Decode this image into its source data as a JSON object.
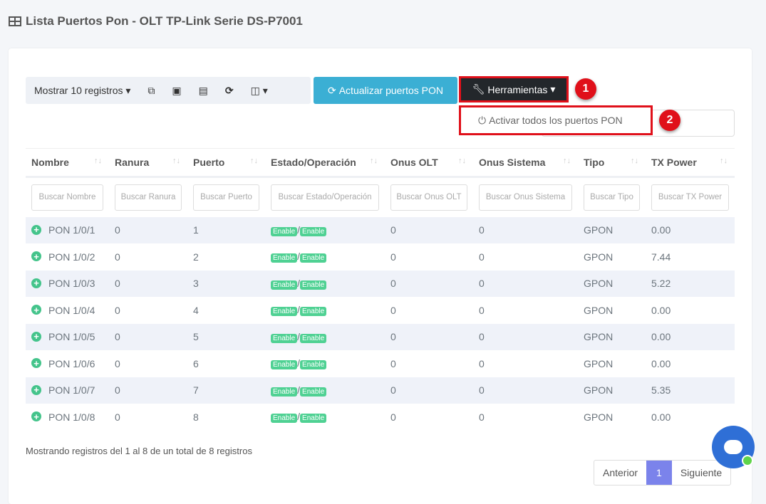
{
  "title": "Lista Puertos Pon - OLT TP-Link Serie DS-P7001",
  "toolbar": {
    "show": "Mostrar 10 registros",
    "update": "Actualizar puertos PON",
    "tools": "Herramientas",
    "menu_item": "Activar todos los puertos PON",
    "marker1": "1",
    "marker2": "2"
  },
  "columns": [
    "Nombre",
    "Ranura",
    "Puerto",
    "Estado/Operación",
    "Onus OLT",
    "Onus Sistema",
    "Tipo",
    "TX Power"
  ],
  "filters": [
    "Buscar Nombre",
    "Buscar Ranura",
    "Buscar Puerto",
    "Buscar Estado/Operación",
    "Buscar Onus OLT",
    "Buscar Onus Sistema",
    "Buscar Tipo",
    "Buscar TX Power"
  ],
  "rows": [
    {
      "name": "PON 1/0/1",
      "slot": "0",
      "port": "1",
      "state": "Enable",
      "op": "Enable",
      "olt": "0",
      "sys": "0",
      "type": "GPON",
      "tx": "0.00"
    },
    {
      "name": "PON 1/0/2",
      "slot": "0",
      "port": "2",
      "state": "Enable",
      "op": "Enable",
      "olt": "0",
      "sys": "0",
      "type": "GPON",
      "tx": "7.44"
    },
    {
      "name": "PON 1/0/3",
      "slot": "0",
      "port": "3",
      "state": "Enable",
      "op": "Enable",
      "olt": "0",
      "sys": "0",
      "type": "GPON",
      "tx": "5.22"
    },
    {
      "name": "PON 1/0/4",
      "slot": "0",
      "port": "4",
      "state": "Enable",
      "op": "Enable",
      "olt": "0",
      "sys": "0",
      "type": "GPON",
      "tx": "0.00"
    },
    {
      "name": "PON 1/0/5",
      "slot": "0",
      "port": "5",
      "state": "Enable",
      "op": "Enable",
      "olt": "0",
      "sys": "0",
      "type": "GPON",
      "tx": "0.00"
    },
    {
      "name": "PON 1/0/6",
      "slot": "0",
      "port": "6",
      "state": "Enable",
      "op": "Enable",
      "olt": "0",
      "sys": "0",
      "type": "GPON",
      "tx": "0.00"
    },
    {
      "name": "PON 1/0/7",
      "slot": "0",
      "port": "7",
      "state": "Enable",
      "op": "Enable",
      "olt": "0",
      "sys": "0",
      "type": "GPON",
      "tx": "5.35"
    },
    {
      "name": "PON 1/0/8",
      "slot": "0",
      "port": "8",
      "state": "Enable",
      "op": "Enable",
      "olt": "0",
      "sys": "0",
      "type": "GPON",
      "tx": "0.00"
    }
  ],
  "footer": "Mostrando registros del 1 al 8 de un total de 8 registros",
  "pager": {
    "prev": "Anterior",
    "page": "1",
    "next": "Siguiente"
  }
}
